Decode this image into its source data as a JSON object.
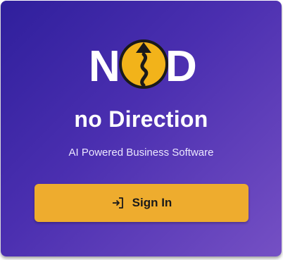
{
  "brand": {
    "logo_text": "NOD",
    "name": "no Direction",
    "tagline": "AI Powered Business Software"
  },
  "signin_button": {
    "label": "Sign In",
    "icon": "login-icon"
  },
  "colors": {
    "gradient_start": "#2f1f9c",
    "gradient_end": "#7550c4",
    "accent": "#eeac2e"
  }
}
